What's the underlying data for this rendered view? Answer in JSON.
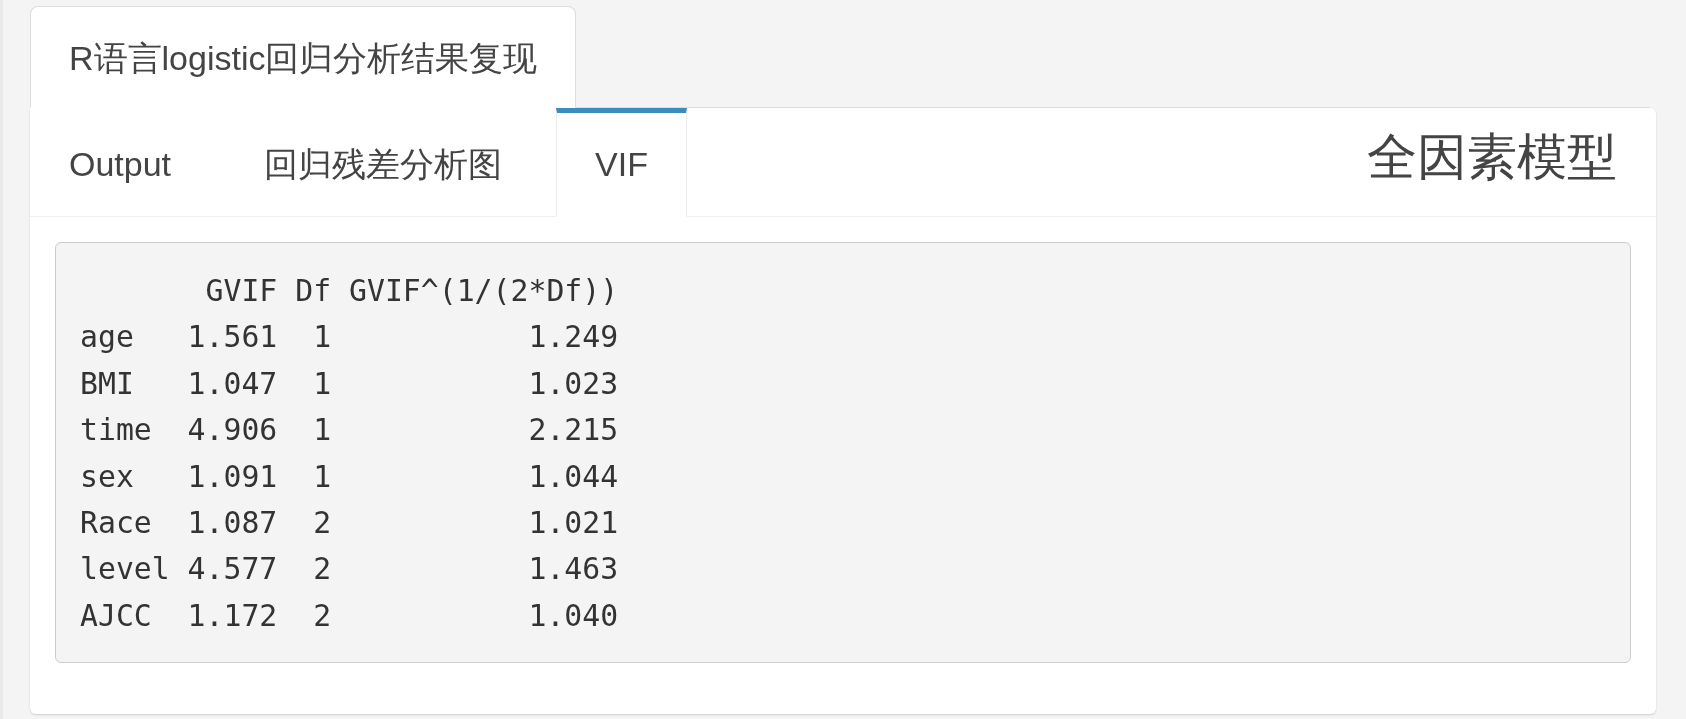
{
  "outer_tabs": [
    {
      "label": "R语言logistic回归分析结果复现",
      "selected": true
    }
  ],
  "tab_box": {
    "title": "全因素模型",
    "tabs": [
      {
        "label": "Output",
        "selected": false
      },
      {
        "label": "回归残差分析图",
        "selected": false
      },
      {
        "label": "VIF",
        "selected": true
      }
    ],
    "vif_output": {
      "columns": [
        "GVIF",
        "Df",
        "GVIF^(1/(2*Df))"
      ],
      "rows": [
        {
          "term": "age",
          "values": [
            "1.561",
            "1",
            "1.249"
          ]
        },
        {
          "term": "BMI",
          "values": [
            "1.047",
            "1",
            "1.023"
          ]
        },
        {
          "term": "time",
          "values": [
            "4.906",
            "1",
            "2.215"
          ]
        },
        {
          "term": "sex",
          "values": [
            "1.091",
            "1",
            "1.044"
          ]
        },
        {
          "term": "Race",
          "values": [
            "1.087",
            "2",
            "1.021"
          ]
        },
        {
          "term": "level",
          "values": [
            "4.577",
            "2",
            "1.463"
          ]
        },
        {
          "term": "AJCC",
          "values": [
            "1.172",
            "2",
            "1.040"
          ]
        }
      ]
    }
  }
}
